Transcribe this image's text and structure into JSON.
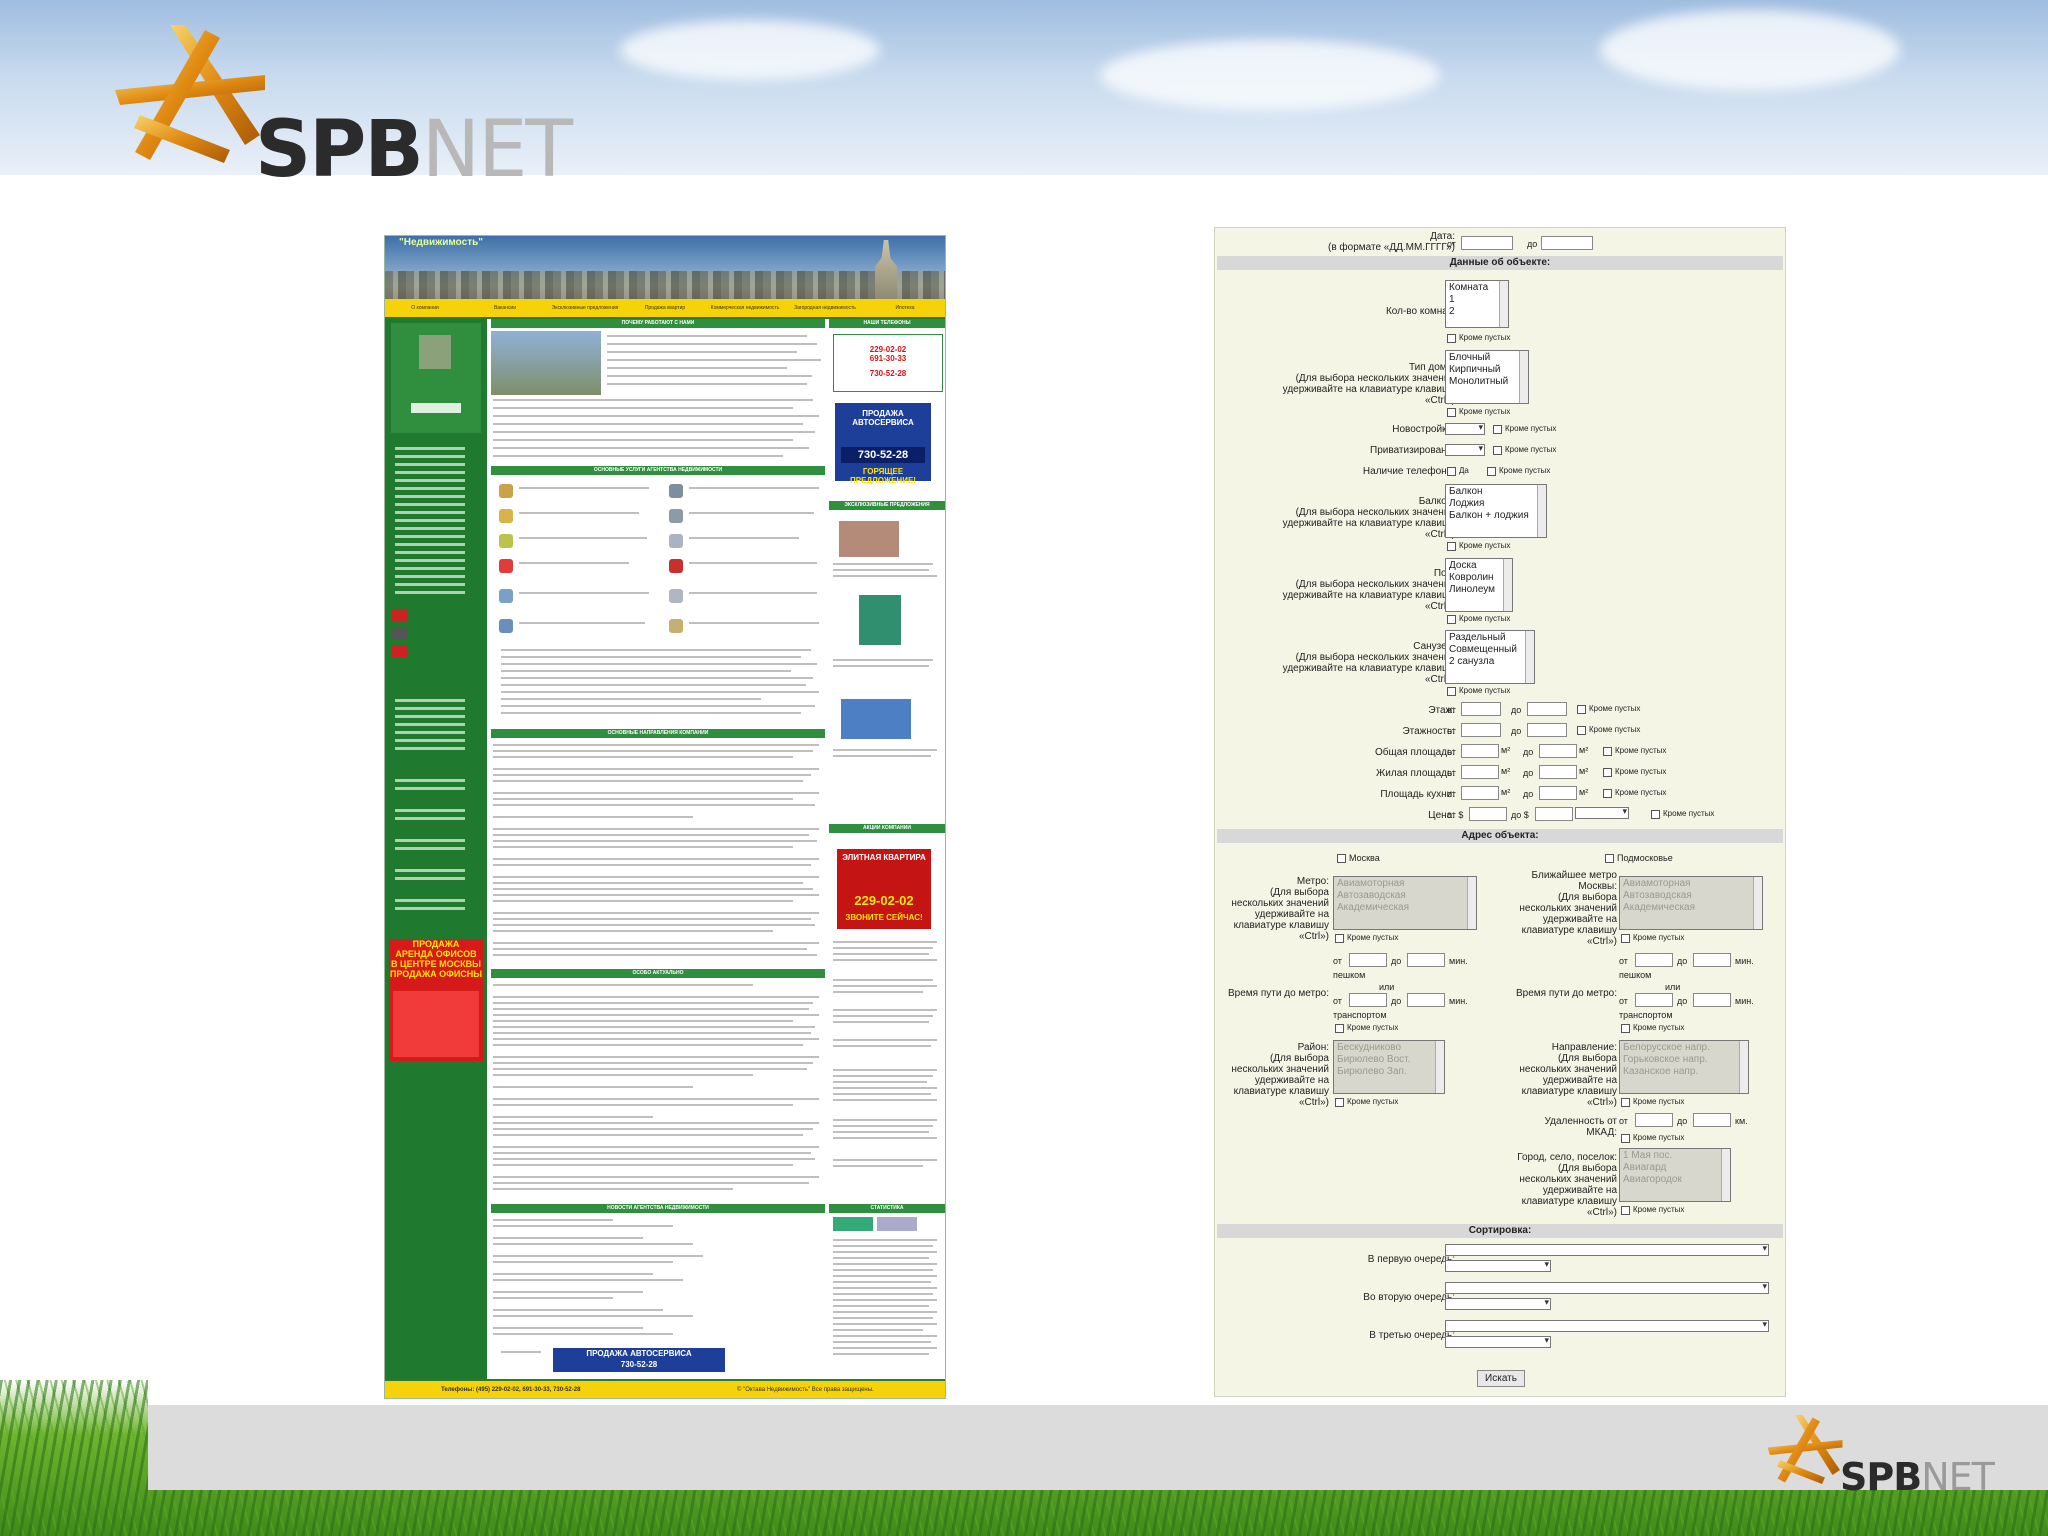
{
  "brand": {
    "name_dark": "SPB",
    "name_light": "NET"
  },
  "site": {
    "brand": "\"Недвижимость\"",
    "menu": [
      "О компании",
      "Вакансии",
      "Эксклюзивные предложения",
      "Продажа квартир",
      "Коммерческая недвижимость",
      "Загородная недвижимость",
      "Ипотека"
    ],
    "section_why": "ПОЧЕМУ РАБОТАЮТ С НАМИ",
    "section_services": "ОСНОВНЫЕ УСЛУГИ АГЕНТСТВА НЕДВИЖИМОСТИ",
    "section_directions": "ОСНОВНЫЕ НАПРАВЛЕНИЯ КОМПАНИИ",
    "section_actual": "ОСОБО АКТУАЛЬНО",
    "section_news": "НОВОСТИ АГЕНТСТВА НЕДВИЖИМОСТИ",
    "section_phones": "НАШИ ТЕЛЕФОНЫ",
    "section_exclusive": "ЭКСКЛЮЗИВНЫЕ ПРЕДЛОЖЕНИЯ",
    "section_actions": "АКЦИИ КОМПАНИИ",
    "section_stats": "СТАТИСТИКА",
    "phones": [
      "229-02-02",
      "691-30-33",
      "730-52-28"
    ],
    "auto_ad": {
      "line1": "ПРОДАЖА АВТОСЕРВИСА",
      "phone": "730-52-28",
      "line2": "ГОРЯЩЕЕ ПРЕДЛОЖЕНИЕ!"
    },
    "flat_ad": {
      "line1": "ЭЛИТНАЯ КВАРТИРА",
      "phone": "229-02-02",
      "line2": "ЗВОНИТЕ СЕЙЧАС!"
    },
    "office_ad": [
      "ПРОДАЖА",
      "АРЕНДА ОФИСОВ",
      "В ЦЕНТРЕ МОСКВЫ",
      "ПРОДАЖА ОФИСНЫ"
    ],
    "footer_phones": "Телефоны: (495) 229-02-02, 691-30-33, 730-52-28",
    "footer_copy": "© \"Октава Недвижимость\" Все права защищены.",
    "footer_auto": {
      "line1": "ПРОДАЖА АВТОСЕРВИСА",
      "phone": "730-52-28"
    }
  },
  "form": {
    "date": {
      "label_line1": "Дата:",
      "label_line2": "(в формате «ДД.ММ.ГГГГ»)",
      "from": "от",
      "to": "до"
    },
    "section_object": "Данные об объекте:",
    "rooms": {
      "label": "Кол-во комнат:",
      "options": [
        "Комната",
        "1",
        "2"
      ],
      "empty": "Кроме пустых"
    },
    "house_type": {
      "label_line1": "Тип дома:",
      "label_line2": "(Для выбора нескольких значений",
      "label_line3": "удерживайте на клавиатуре клавишу",
      "label_line4": "«Ctrl»)",
      "options": [
        "Блочный",
        "Кирпичный",
        "Монолитный"
      ],
      "empty": "Кроме пустых"
    },
    "new_building": {
      "label": "Новостройка:",
      "empty": "Кроме пустых"
    },
    "privatized": {
      "label": "Приватизирована:",
      "empty": "Кроме пустых"
    },
    "phone": {
      "label": "Наличие телефона:",
      "yes": "Да",
      "empty": "Кроме пустых"
    },
    "balcony": {
      "label_line1": "Балкон:",
      "label_line2": "(Для выбора нескольких значений",
      "label_line3": "удерживайте на клавиатуре клавишу",
      "label_line4": "«Ctrl»)",
      "options": [
        "Балкон",
        "Лоджия",
        "Балкон + лоджия"
      ],
      "empty": "Кроме пустых"
    },
    "floor_cover": {
      "label_line1": "Пол:",
      "label_line2": "(Для выбора нескольких значений",
      "label_line3": "удерживайте на клавиатуре клавишу",
      "label_line4": "«Ctrl»)",
      "options": [
        "Доска",
        "Ковролин",
        "Линолеум"
      ],
      "empty": "Кроме пустых"
    },
    "bathroom": {
      "label_line1": "Санузел:",
      "label_line2": "(Для выбора нескольких значений",
      "label_line3": "удерживайте на клавиатуре клавишу",
      "label_line4": "«Ctrl»)",
      "options": [
        "Раздельный",
        "Совмещенный",
        "2 санузла"
      ],
      "empty": "Кроме пустых"
    },
    "floor": {
      "label": "Этаж:",
      "from": "от",
      "to": "до",
      "empty": "Кроме пустых"
    },
    "floors_total": {
      "label": "Этажность:",
      "from": "от",
      "to": "до",
      "empty": "Кроме пустых"
    },
    "area_total": {
      "label": "Общая площадь:",
      "from": "от",
      "to": "до",
      "unit": "м²",
      "empty": "Кроме пустых"
    },
    "area_living": {
      "label": "Жилая площадь:",
      "from": "от",
      "to": "до",
      "unit": "м²",
      "empty": "Кроме пустых"
    },
    "area_kitchen": {
      "label": "Площадь кухни:",
      "from": "от",
      "to": "до",
      "unit": "м²",
      "empty": "Кроме пустых"
    },
    "price": {
      "label": "Цена:",
      "from": "от $",
      "to": "до $",
      "empty": "Кроме пустых"
    },
    "section_address": "Адрес объекта:",
    "moscow": "Москва",
    "region": "Подмосковье",
    "metro": {
      "label_line1": "Метро:",
      "label_line2": "(Для выбора",
      "label_line3": "нескольких значений",
      "label_line4": "удерживайте на",
      "label_line5": "клавиатуре клавишу",
      "label_line6": "«Ctrl»)",
      "options": [
        "Авиамоторная",
        "Автозаводская",
        "Академическая"
      ],
      "empty": "Кроме пустых"
    },
    "metro_near": {
      "label_line1": "Ближайшее метро",
      "label_line2": "Москвы:",
      "label_line3": "(Для выбора",
      "label_line4": "нескольких значений",
      "label_line5": "удерживайте на",
      "label_line6": "клавиатуре клавишу",
      "label_line7": "«Ctrl»)",
      "options": [
        "Авиамоторная",
        "Автозаводская",
        "Академическая"
      ],
      "empty": "Кроме пустых"
    },
    "travel": {
      "label": "Время пути до метро:",
      "from": "от",
      "to": "до",
      "unit": "мин.",
      "walk": "пешком",
      "or": "или",
      "transport": "транспортом",
      "empty": "Кроме пустых"
    },
    "district": {
      "label_line1": "Район:",
      "label_line2": "(Для выбора",
      "label_line3": "нескольких значений",
      "label_line4": "удерживайте на",
      "label_line5": "клавиатуре клавишу",
      "label_line6": "«Ctrl»)",
      "options": [
        "Бескудниково",
        "Бирюлево Вост.",
        "Бирюлево Зап."
      ],
      "empty": "Кроме пустых"
    },
    "direction": {
      "label_line1": "Направление:",
      "label_line2": "(Для выбора",
      "label_line3": "нескольких значений",
      "label_line4": "удерживайте на",
      "label_line5": "клавиатуре клавишу",
      "label_line6": "«Ctrl»)",
      "options": [
        "Белорусское напр.",
        "Горьковское напр.",
        "Казанское напр."
      ],
      "empty": "Кроме пустых"
    },
    "mkad": {
      "label_line1": "Удаленность от",
      "label_line2": "МКАД:",
      "from": "от",
      "to": "до",
      "unit": "км.",
      "empty": "Кроме пустых"
    },
    "town": {
      "label_line1": "Город, село, поселок:",
      "label_line2": "(Для выбора",
      "label_line3": "нескольких значений",
      "label_line4": "удерживайте на",
      "label_line5": "клавиатуре клавишу",
      "label_line6": "«Ctrl»)",
      "options": [
        "1 Мая пос.",
        "Авиагард",
        "Авиагородок"
      ],
      "empty": "Кроме пустых"
    },
    "section_sort": "Сортировка:",
    "sort1": "В первую очередь:",
    "sort2": "Во вторую очередь:",
    "sort3": "В третью очередь:",
    "submit": "Искать"
  }
}
